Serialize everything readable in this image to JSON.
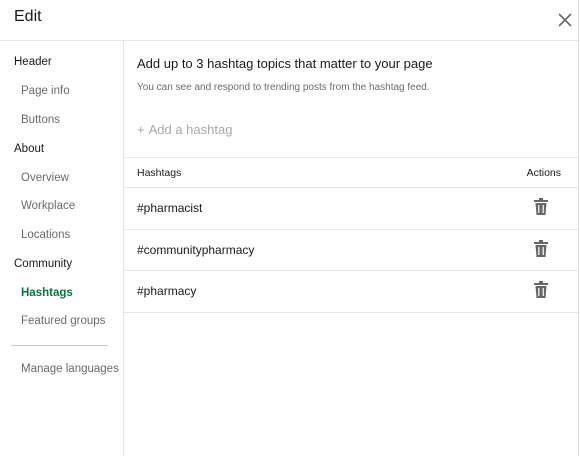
{
  "header": {
    "title": "Edit",
    "close_icon": "close-icon"
  },
  "sidebar": {
    "sections": [
      {
        "label": "Header",
        "items": [
          {
            "label": "Page info"
          },
          {
            "label": "Buttons"
          }
        ]
      },
      {
        "label": "About",
        "items": [
          {
            "label": "Overview"
          },
          {
            "label": "Workplace"
          },
          {
            "label": "Locations"
          }
        ]
      },
      {
        "label": "Community",
        "items": [
          {
            "label": "Hashtags",
            "active": true
          },
          {
            "label": "Featured groups"
          }
        ]
      }
    ],
    "footer_item": "Manage languages",
    "active_color": "#057642"
  },
  "main": {
    "heading": "Add up to 3 hashtag topics that matter to your page",
    "subheading": "You can see and respond to trending posts from the hashtag feed.",
    "add_button": {
      "plus": "+",
      "label": "Add a hashtag"
    },
    "table": {
      "headers": {
        "hashtags": "Hashtags",
        "actions": "Actions"
      },
      "rows": [
        {
          "hashtag": "#pharmacist",
          "action_icon": "trash-icon"
        },
        {
          "hashtag": "#communitypharmacy",
          "action_icon": "trash-icon"
        },
        {
          "hashtag": "#pharmacy",
          "action_icon": "trash-icon"
        }
      ]
    }
  }
}
